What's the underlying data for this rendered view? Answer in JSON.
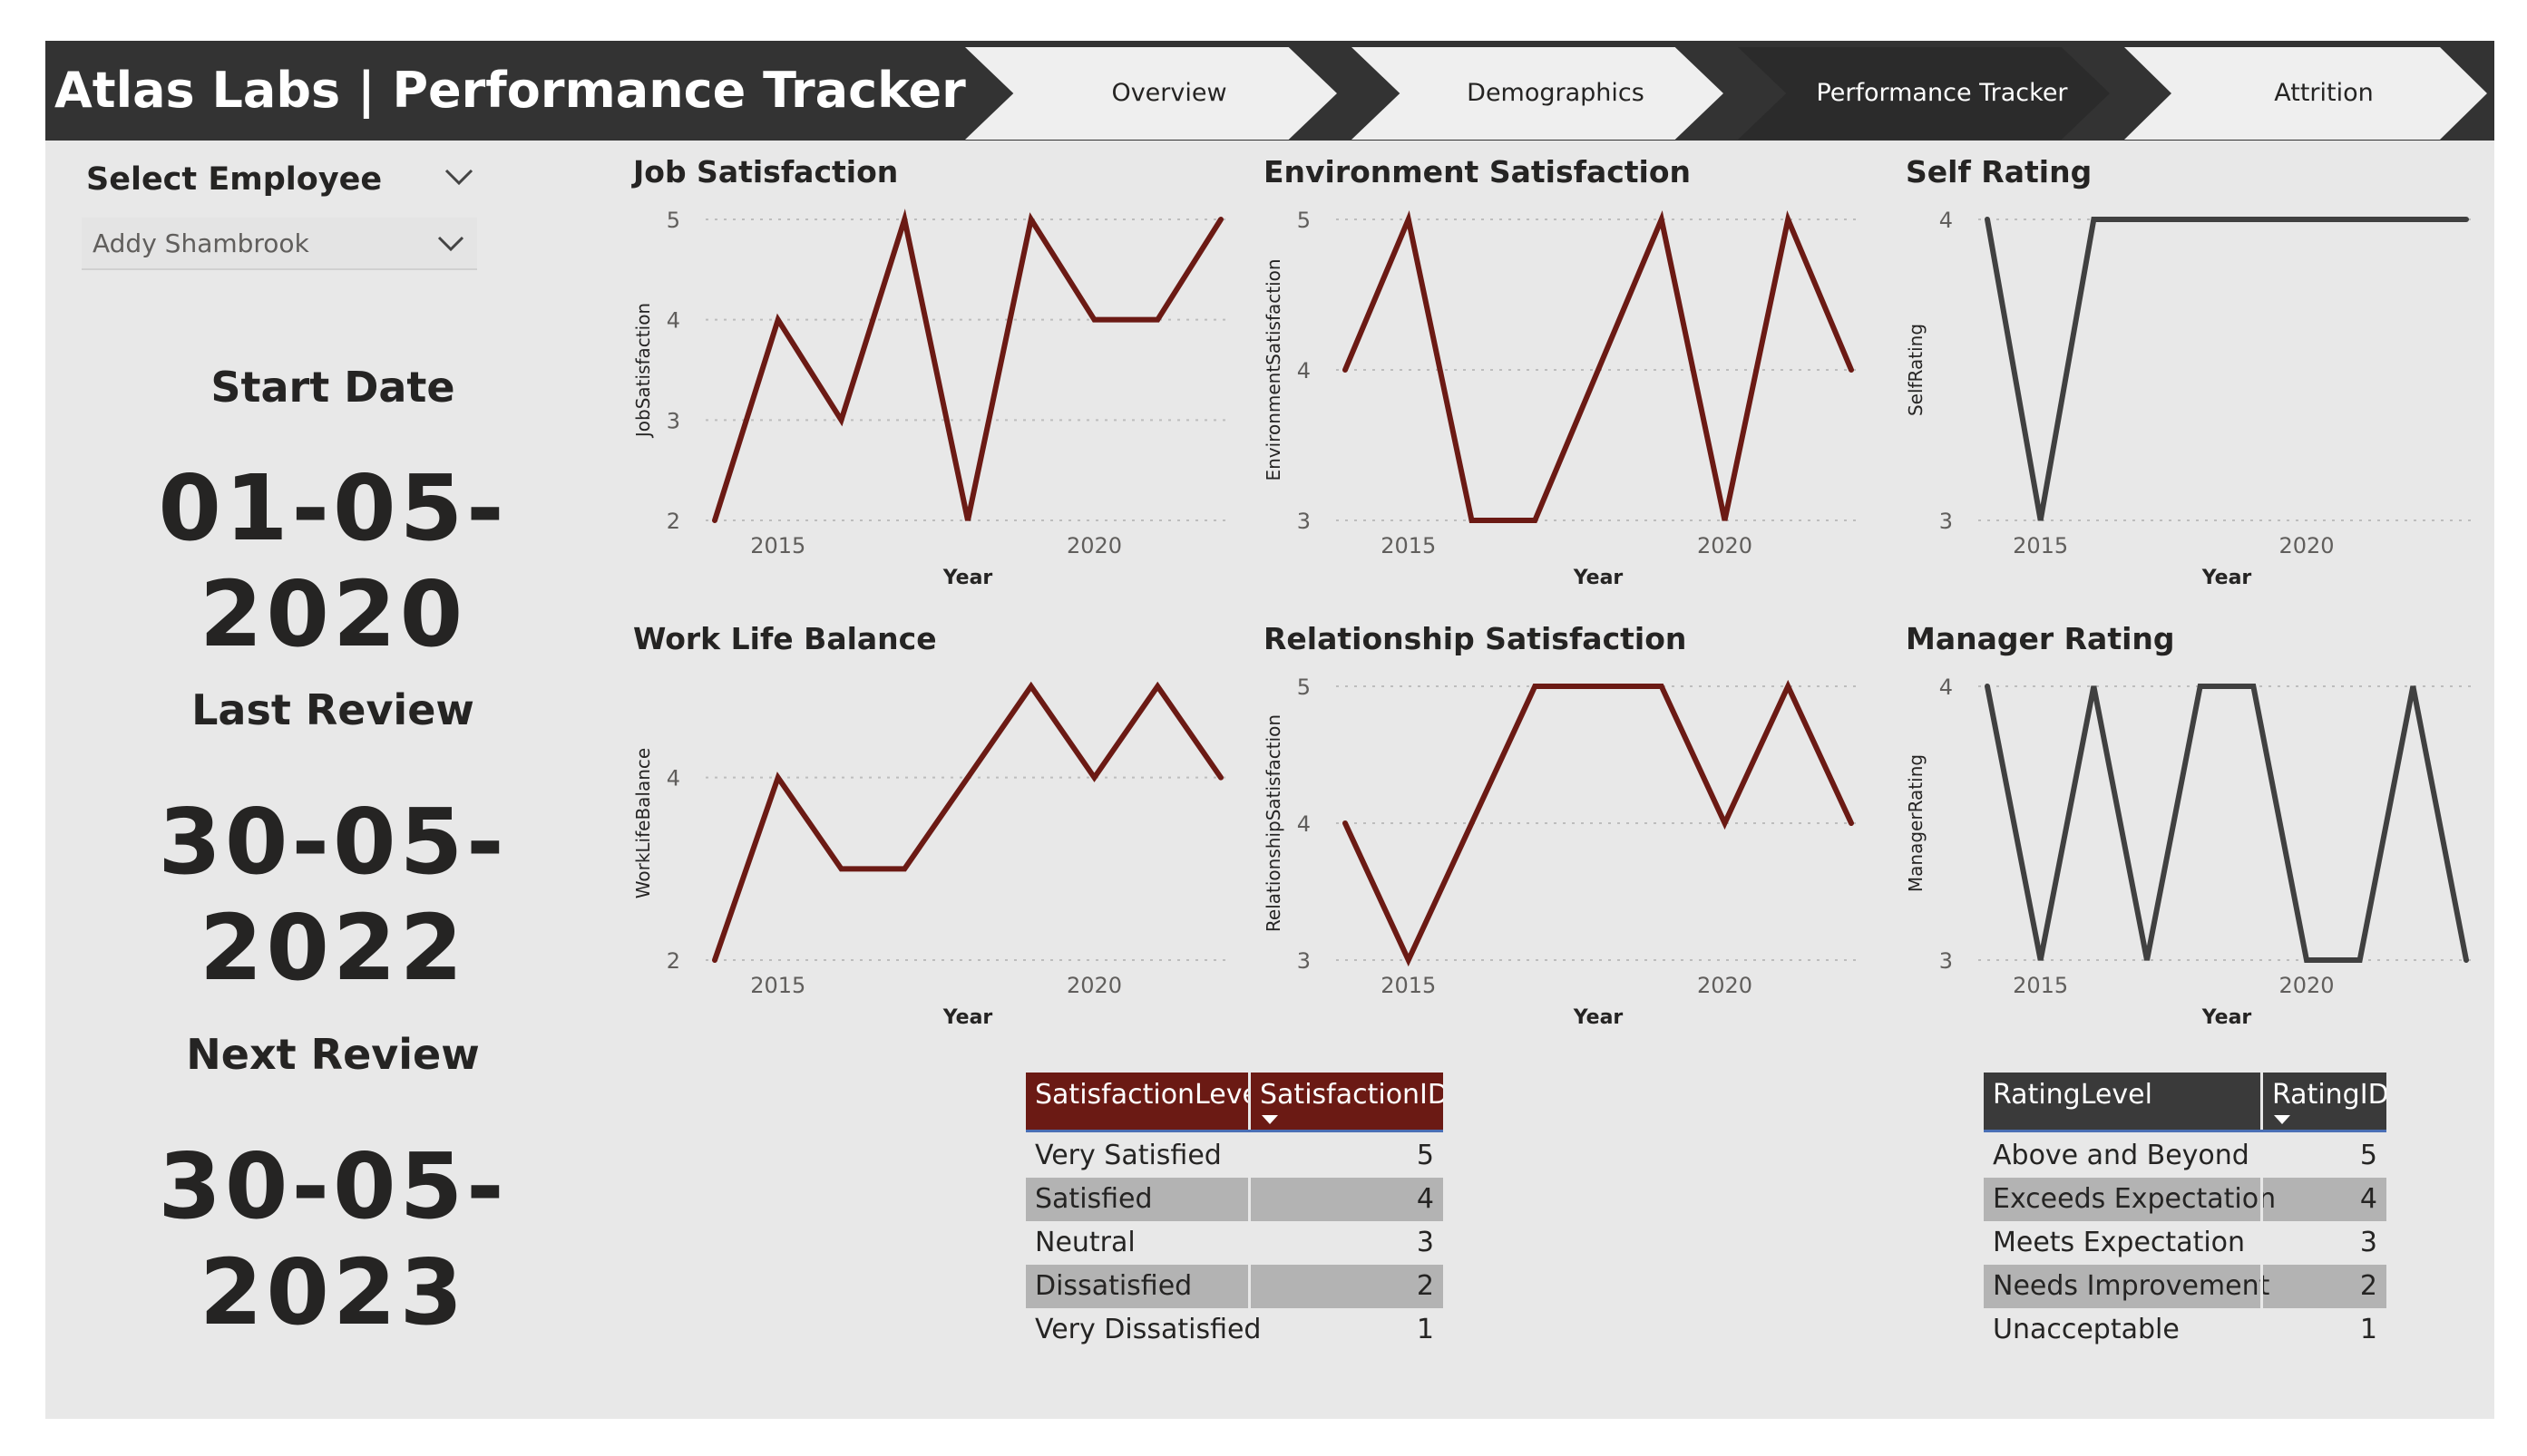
{
  "app_title": "Atlas Labs | Performance Tracker",
  "tabs": [
    {
      "label": "Overview",
      "active": false
    },
    {
      "label": "Demographics",
      "active": false
    },
    {
      "label": "Performance Tracker",
      "active": true
    },
    {
      "label": "Attrition",
      "active": false
    }
  ],
  "employee": {
    "label": "Select Employee",
    "selected": "Addy Shambrook"
  },
  "kpis": [
    {
      "label": "Start Date",
      "value": "01-05-2020"
    },
    {
      "label": "Last Review",
      "value": "30-05-2022"
    },
    {
      "label": "Next Review",
      "value": "30-05-2023"
    }
  ],
  "colors": {
    "accent": "#6b1a14",
    "rating_line": "#404040",
    "header_bg": "#333333",
    "rating_header": "#3a3a3a"
  },
  "chart_data": [
    {
      "id": "job",
      "type": "line",
      "title": "Job Satisfaction",
      "xlabel": "Year",
      "ylabel": "JobSatisfaction",
      "x": [
        2014,
        2015,
        2016,
        2017,
        2018,
        2019,
        2020,
        2021,
        2022
      ],
      "values": [
        2,
        4,
        3,
        5,
        2,
        5,
        4,
        4,
        5
      ],
      "ylim": [
        2,
        5
      ],
      "yticks": [
        2,
        3,
        4,
        5
      ],
      "xticks": [
        2015,
        2020
      ],
      "color": "#6b1a14"
    },
    {
      "id": "env",
      "type": "line",
      "title": "Environment Satisfaction",
      "xlabel": "Year",
      "ylabel": "EnvironmentSatisfaction",
      "x": [
        2014,
        2015,
        2016,
        2017,
        2018,
        2019,
        2020,
        2021,
        2022
      ],
      "values": [
        4,
        5,
        3,
        3,
        4,
        5,
        3,
        5,
        4
      ],
      "ylim": [
        3,
        5
      ],
      "yticks": [
        3,
        4,
        5
      ],
      "xticks": [
        2015,
        2020
      ],
      "color": "#6b1a14"
    },
    {
      "id": "self",
      "type": "line",
      "title": "Self Rating",
      "xlabel": "Year",
      "ylabel": "SelfRating",
      "x": [
        2014,
        2015,
        2016,
        2017,
        2018,
        2019,
        2020,
        2021,
        2022,
        2023
      ],
      "values": [
        4,
        3,
        4,
        4,
        4,
        4,
        4,
        4,
        4,
        4
      ],
      "ylim": [
        3,
        4
      ],
      "yticks": [
        3,
        4
      ],
      "xticks": [
        2015,
        2020
      ],
      "color": "#404040"
    },
    {
      "id": "wlb",
      "type": "line",
      "title": "Work Life Balance",
      "xlabel": "Year",
      "ylabel": "WorkLifeBalance",
      "x": [
        2014,
        2015,
        2016,
        2017,
        2018,
        2019,
        2020,
        2021,
        2022
      ],
      "values": [
        2,
        4,
        3,
        3,
        4,
        5,
        4,
        5,
        4
      ],
      "ylim": [
        2,
        5
      ],
      "yticks": [
        2,
        4
      ],
      "xticks": [
        2015,
        2020
      ],
      "color": "#6b1a14"
    },
    {
      "id": "rel",
      "type": "line",
      "title": "Relationship Satisfaction",
      "xlabel": "Year",
      "ylabel": "RelationshipSatisfaction",
      "x": [
        2014,
        2015,
        2016,
        2017,
        2018,
        2019,
        2020,
        2021,
        2022
      ],
      "values": [
        4,
        3,
        4,
        5,
        5,
        5,
        4,
        5,
        4
      ],
      "ylim": [
        3,
        5
      ],
      "yticks": [
        3,
        4,
        5
      ],
      "xticks": [
        2015,
        2020
      ],
      "color": "#6b1a14"
    },
    {
      "id": "mgr",
      "type": "line",
      "title": "Manager Rating",
      "xlabel": "Year",
      "ylabel": "ManagerRating",
      "x": [
        2014,
        2015,
        2016,
        2017,
        2018,
        2019,
        2020,
        2021,
        2022,
        2023
      ],
      "values": [
        4,
        3,
        4,
        3,
        4,
        4,
        3,
        3,
        4,
        3
      ],
      "ylim": [
        3,
        4
      ],
      "yticks": [
        3,
        4
      ],
      "xticks": [
        2015,
        2020
      ],
      "color": "#404040"
    }
  ],
  "satisfaction_table": {
    "headers": [
      "SatisfactionLevel",
      "SatisfactionID"
    ],
    "rows": [
      [
        "Very Satisfied",
        "5"
      ],
      [
        "Satisfied",
        "4"
      ],
      [
        "Neutral",
        "3"
      ],
      [
        "Dissatisfied",
        "2"
      ],
      [
        "Very Dissatisfied",
        "1"
      ]
    ]
  },
  "rating_table": {
    "headers": [
      "RatingLevel",
      "RatingID"
    ],
    "rows": [
      [
        "Above and Beyond",
        "5"
      ],
      [
        "Exceeds Expectation",
        "4"
      ],
      [
        "Meets Expectation",
        "3"
      ],
      [
        "Needs Improvement",
        "2"
      ],
      [
        "Unacceptable",
        "1"
      ]
    ]
  }
}
